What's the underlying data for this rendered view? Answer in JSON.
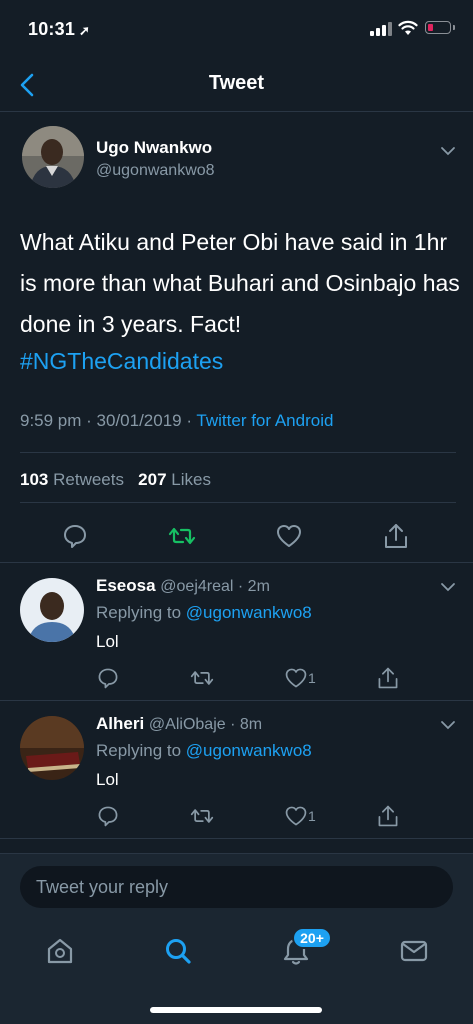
{
  "status": {
    "time": "10:31",
    "battery_color": "#e0245e"
  },
  "header": {
    "title": "Tweet"
  },
  "tweet": {
    "author_name": "Ugo Nwankwo",
    "author_handle": "@ugonwankwo8",
    "text": "What Atiku and Peter Obi have said in 1hr is more than what Buhari and Osinbajo has done in 3 years. Fact!",
    "hashtag": "#NGTheCandidates",
    "timestamp": "9:59 pm · 30/01/2019 · ",
    "source": "Twitter for Android",
    "retweets_count": "103",
    "retweets_label": "Retweets",
    "likes_count": "207",
    "likes_label": "Likes"
  },
  "replies": [
    {
      "name": "Eseosa",
      "handle": "@oej4real · 2m",
      "replying_prefix": "Replying to ",
      "replying_to": "@ugonwankwo8",
      "text": "Lol",
      "likes": "1"
    },
    {
      "name": "Alheri",
      "handle": "@AliObaje · 8m",
      "replying_prefix": "Replying to ",
      "replying_to": "@ugonwankwo8",
      "text": "Lol",
      "likes": "1"
    }
  ],
  "reply_box": {
    "placeholder": "Tweet your reply"
  },
  "tabs": {
    "notifications_badge": "20+"
  },
  "colors": {
    "background": "#141d26",
    "accent": "#1da1f2",
    "retweet": "#17bf63",
    "secondary_text": "#8899a6"
  },
  "icons": [
    "back-icon",
    "chevron-down-icon",
    "comment-icon",
    "retweet-icon",
    "heart-icon",
    "share-icon",
    "home-icon",
    "search-icon",
    "bell-icon",
    "mail-icon"
  ]
}
